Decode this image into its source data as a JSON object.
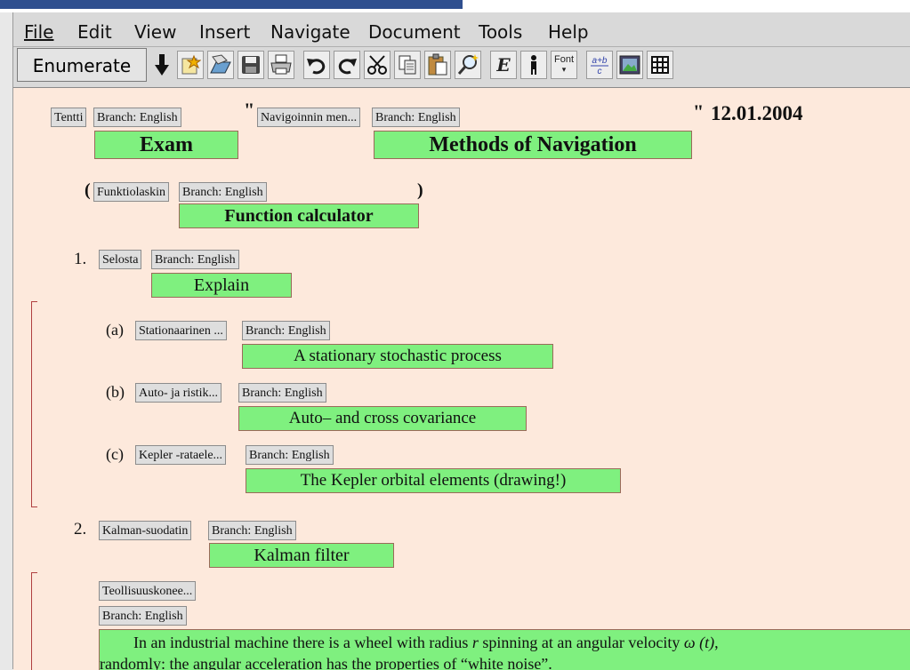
{
  "menu": {
    "file": "File",
    "edit": "Edit",
    "view": "View",
    "insert": "Insert",
    "navigate": "Navigate",
    "document": "Document",
    "tools": "Tools",
    "help": "Help"
  },
  "toolbar": {
    "enumerate_label": "Enumerate",
    "font_label": "Font",
    "emph_label": "E",
    "frac_label": "a+b/c",
    "icons": [
      "down-arrow",
      "new",
      "open",
      "save",
      "print",
      "undo",
      "redo",
      "cut",
      "copy",
      "paste",
      "search",
      "emphasize",
      "person",
      "font",
      "fraction",
      "image",
      "table"
    ]
  },
  "doc": {
    "header": {
      "tag1": "Tentti",
      "branch1": "Branch: English",
      "quote1": "\"",
      "tag2": "Navigoinnin men...",
      "branch2": "Branch: English",
      "quote2": "\"",
      "date": "12.01.2004",
      "exam": "Exam",
      "course": "Methods of Navigation"
    },
    "aid": {
      "open_paren": "(",
      "tag": "Funktiolaskin",
      "branch": "Branch: English",
      "close_paren": ")",
      "text": "Function calculator"
    },
    "q1": {
      "number": "1.",
      "tag": "Selosta",
      "branch": "Branch: English",
      "text": "Explain",
      "items": [
        {
          "label": "(a)",
          "tag": "Stationaarinen ...",
          "branch": "Branch: English",
          "text": "A stationary stochastic process"
        },
        {
          "label": "(b)",
          "tag": "Auto- ja ristik...",
          "branch": "Branch: English",
          "text": "Auto– and cross covariance"
        },
        {
          "label": "(c)",
          "tag": "Kepler -rataele...",
          "branch": "Branch: English",
          "text": "The Kepler orbital elements (drawing!)"
        }
      ]
    },
    "q2": {
      "number": "2.",
      "tag": "Kalman-suodatin",
      "branch": "Branch: English",
      "text": "Kalman filter",
      "sub_tag": "Teollisuuskonee...",
      "sub_branch": "Branch: English",
      "para_line1_a": "In an industrial machine there is a wheel with radius",
      "para_r": "r",
      "para_line1_b": "spinning at an angular velocity",
      "para_omega": "ω (t)",
      "para_comma": ",",
      "para_line2": "randomly: the angular acceleration has the properties of “white noise”."
    }
  }
}
